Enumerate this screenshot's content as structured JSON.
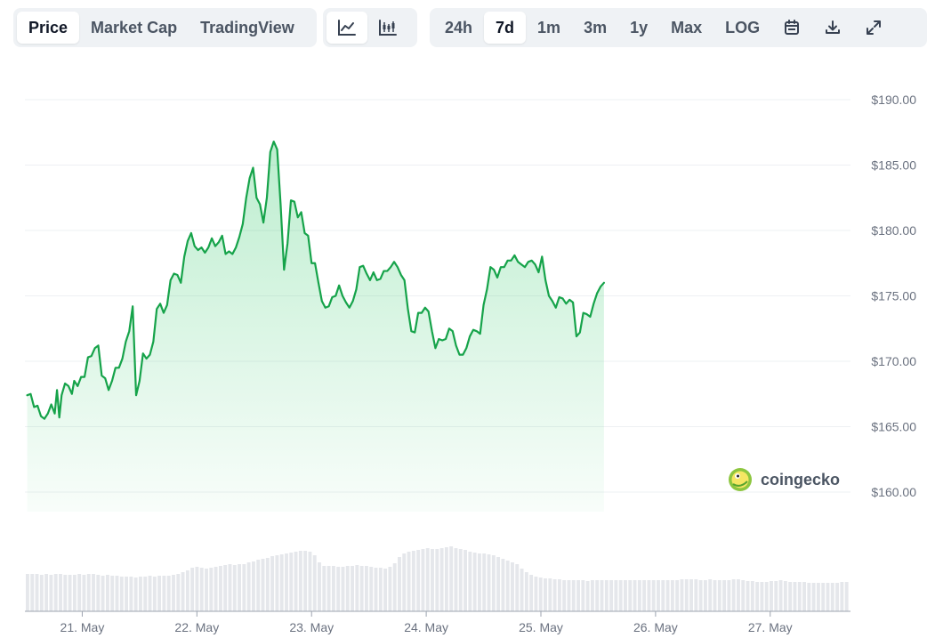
{
  "toolbar": {
    "view_tabs": [
      {
        "label": "Price",
        "active": true
      },
      {
        "label": "Market Cap",
        "active": false
      },
      {
        "label": "TradingView",
        "active": false
      }
    ],
    "chart_type_icons": [
      "line-chart-icon",
      "candlestick-chart-icon"
    ],
    "ranges": [
      {
        "label": "24h",
        "active": false
      },
      {
        "label": "7d",
        "active": true
      },
      {
        "label": "1m",
        "active": false
      },
      {
        "label": "3m",
        "active": false
      },
      {
        "label": "1y",
        "active": false
      },
      {
        "label": "Max",
        "active": false
      }
    ],
    "log_label": "LOG",
    "action_icons": [
      "calendar-icon",
      "download-icon",
      "expand-icon"
    ]
  },
  "watermark": {
    "text": "coingecko"
  },
  "colors": {
    "line": "#16a34a",
    "fill": "#22c55e",
    "volume": "#e5e7eb",
    "grid": "#eef0f3",
    "axis_text": "#6b7280",
    "active_bg": "#ffffff",
    "toolbar_bg": "#eff2f5"
  },
  "chart_data": {
    "type": "area",
    "grid": true,
    "y_axis_position": "right",
    "ylim": [
      158.5,
      191.5
    ],
    "y_ticks": [
      160,
      165,
      170,
      175,
      180,
      185,
      190
    ],
    "y_tick_labels": [
      "$160.00",
      "$165.00",
      "$170.00",
      "$175.00",
      "$180.00",
      "$185.00",
      "$190.00"
    ],
    "xlim": [
      20.5,
      27.7
    ],
    "x_ticks": [
      21,
      22,
      23,
      24,
      25,
      26,
      27
    ],
    "x_tick_labels": [
      "21. May",
      "22. May",
      "23. May",
      "24. May",
      "25. May",
      "26. May",
      "27. May"
    ],
    "series": [
      {
        "type": "area",
        "points": [
          [
            20.52,
            167.4
          ],
          [
            20.55,
            167.5
          ],
          [
            20.58,
            166.5
          ],
          [
            20.61,
            166.6
          ],
          [
            20.64,
            165.8
          ],
          [
            20.67,
            165.6
          ],
          [
            20.7,
            166.0
          ],
          [
            20.73,
            166.7
          ],
          [
            20.76,
            166.0
          ],
          [
            20.78,
            167.8
          ],
          [
            20.8,
            165.7
          ],
          [
            20.82,
            167.4
          ],
          [
            20.85,
            168.3
          ],
          [
            20.88,
            168.1
          ],
          [
            20.91,
            167.5
          ],
          [
            20.93,
            168.5
          ],
          [
            20.96,
            168.1
          ],
          [
            20.99,
            168.8
          ],
          [
            21.02,
            168.8
          ],
          [
            21.05,
            170.3
          ],
          [
            21.08,
            170.4
          ],
          [
            21.11,
            171.0
          ],
          [
            21.14,
            171.2
          ],
          [
            21.17,
            168.9
          ],
          [
            21.2,
            168.7
          ],
          [
            21.23,
            167.8
          ],
          [
            21.26,
            168.5
          ],
          [
            21.29,
            169.5
          ],
          [
            21.32,
            169.5
          ],
          [
            21.35,
            170.2
          ],
          [
            21.38,
            171.5
          ],
          [
            21.41,
            172.3
          ],
          [
            21.44,
            174.2
          ],
          [
            21.47,
            167.4
          ],
          [
            21.5,
            168.5
          ],
          [
            21.53,
            170.6
          ],
          [
            21.56,
            170.2
          ],
          [
            21.59,
            170.5
          ],
          [
            21.62,
            171.5
          ],
          [
            21.65,
            174.0
          ],
          [
            21.68,
            174.4
          ],
          [
            21.71,
            173.7
          ],
          [
            21.74,
            174.3
          ],
          [
            21.77,
            176.2
          ],
          [
            21.8,
            176.7
          ],
          [
            21.83,
            176.6
          ],
          [
            21.86,
            176.0
          ],
          [
            21.89,
            178.0
          ],
          [
            21.92,
            179.2
          ],
          [
            21.95,
            179.8
          ],
          [
            21.98,
            178.8
          ],
          [
            22.01,
            178.5
          ],
          [
            22.04,
            178.7
          ],
          [
            22.07,
            178.3
          ],
          [
            22.1,
            178.7
          ],
          [
            22.13,
            179.4
          ],
          [
            22.16,
            178.8
          ],
          [
            22.19,
            179.1
          ],
          [
            22.22,
            179.6
          ],
          [
            22.25,
            178.2
          ],
          [
            22.28,
            178.4
          ],
          [
            22.31,
            178.2
          ],
          [
            22.34,
            178.7
          ],
          [
            22.37,
            179.5
          ],
          [
            22.4,
            180.5
          ],
          [
            22.43,
            182.5
          ],
          [
            22.46,
            184.0
          ],
          [
            22.49,
            184.8
          ],
          [
            22.52,
            182.5
          ],
          [
            22.55,
            182.0
          ],
          [
            22.58,
            180.6
          ],
          [
            22.61,
            182.5
          ],
          [
            22.64,
            186.0
          ],
          [
            22.67,
            186.8
          ],
          [
            22.7,
            186.2
          ],
          [
            22.73,
            182.0
          ],
          [
            22.76,
            177.0
          ],
          [
            22.79,
            179.0
          ],
          [
            22.82,
            182.3
          ],
          [
            22.85,
            182.2
          ],
          [
            22.88,
            181.0
          ],
          [
            22.91,
            181.4
          ],
          [
            22.94,
            179.8
          ],
          [
            22.97,
            179.6
          ],
          [
            23.0,
            177.5
          ],
          [
            23.03,
            177.5
          ],
          [
            23.06,
            176.0
          ],
          [
            23.09,
            174.6
          ],
          [
            23.12,
            174.1
          ],
          [
            23.15,
            174.2
          ],
          [
            23.18,
            174.9
          ],
          [
            23.21,
            175.0
          ],
          [
            23.24,
            175.8
          ],
          [
            23.27,
            175.0
          ],
          [
            23.3,
            174.5
          ],
          [
            23.33,
            174.1
          ],
          [
            23.36,
            174.6
          ],
          [
            23.39,
            175.5
          ],
          [
            23.42,
            177.2
          ],
          [
            23.45,
            177.3
          ],
          [
            23.48,
            176.7
          ],
          [
            23.51,
            176.2
          ],
          [
            23.54,
            176.8
          ],
          [
            23.57,
            176.2
          ],
          [
            23.6,
            176.3
          ],
          [
            23.63,
            176.9
          ],
          [
            23.66,
            176.9
          ],
          [
            23.69,
            177.2
          ],
          [
            23.72,
            177.6
          ],
          [
            23.75,
            177.2
          ],
          [
            23.78,
            176.6
          ],
          [
            23.81,
            176.2
          ],
          [
            23.84,
            174.0
          ],
          [
            23.87,
            172.3
          ],
          [
            23.9,
            172.2
          ],
          [
            23.93,
            173.7
          ],
          [
            23.96,
            173.7
          ],
          [
            23.99,
            174.1
          ],
          [
            24.02,
            173.8
          ],
          [
            24.05,
            172.3
          ],
          [
            24.08,
            171.0
          ],
          [
            24.11,
            171.7
          ],
          [
            24.14,
            171.6
          ],
          [
            24.17,
            171.7
          ],
          [
            24.2,
            172.5
          ],
          [
            24.23,
            172.3
          ],
          [
            24.26,
            171.2
          ],
          [
            24.29,
            170.5
          ],
          [
            24.32,
            170.5
          ],
          [
            24.35,
            171.0
          ],
          [
            24.38,
            171.9
          ],
          [
            24.41,
            172.4
          ],
          [
            24.44,
            172.3
          ],
          [
            24.47,
            172.1
          ],
          [
            24.5,
            174.3
          ],
          [
            24.53,
            175.5
          ],
          [
            24.56,
            177.2
          ],
          [
            24.59,
            177.0
          ],
          [
            24.62,
            176.4
          ],
          [
            24.65,
            177.2
          ],
          [
            24.68,
            177.2
          ],
          [
            24.71,
            177.7
          ],
          [
            24.74,
            177.7
          ],
          [
            24.77,
            178.1
          ],
          [
            24.8,
            177.6
          ],
          [
            24.83,
            177.4
          ],
          [
            24.86,
            177.2
          ],
          [
            24.89,
            177.6
          ],
          [
            24.92,
            177.7
          ],
          [
            24.95,
            177.4
          ],
          [
            24.98,
            176.8
          ],
          [
            25.01,
            178.0
          ],
          [
            25.04,
            176.2
          ],
          [
            25.07,
            175.0
          ],
          [
            25.1,
            174.6
          ],
          [
            25.13,
            174.1
          ],
          [
            25.16,
            174.9
          ],
          [
            25.19,
            174.8
          ],
          [
            25.22,
            174.4
          ],
          [
            25.25,
            174.7
          ],
          [
            25.28,
            174.5
          ],
          [
            25.31,
            171.9
          ],
          [
            25.34,
            172.2
          ],
          [
            25.37,
            173.7
          ],
          [
            25.4,
            173.6
          ],
          [
            25.43,
            173.4
          ],
          [
            25.46,
            174.4
          ],
          [
            25.49,
            175.2
          ],
          [
            25.52,
            175.7
          ],
          [
            25.55,
            176.0
          ]
        ]
      },
      {
        "type": "volume_bars",
        "name": "",
        "relative_values": [
          0.42,
          0.42,
          0.42,
          0.41,
          0.42,
          0.41,
          0.42,
          0.42,
          0.41,
          0.41,
          0.41,
          0.42,
          0.41,
          0.42,
          0.42,
          0.41,
          0.4,
          0.41,
          0.4,
          0.4,
          0.39,
          0.39,
          0.39,
          0.38,
          0.39,
          0.39,
          0.4,
          0.39,
          0.4,
          0.4,
          0.4,
          0.41,
          0.42,
          0.44,
          0.46,
          0.49,
          0.5,
          0.49,
          0.48,
          0.49,
          0.5,
          0.51,
          0.52,
          0.53,
          0.52,
          0.53,
          0.53,
          0.55,
          0.56,
          0.58,
          0.59,
          0.6,
          0.62,
          0.63,
          0.64,
          0.65,
          0.66,
          0.67,
          0.68,
          0.68,
          0.67,
          0.63,
          0.55,
          0.51,
          0.51,
          0.51,
          0.5,
          0.5,
          0.51,
          0.51,
          0.52,
          0.51,
          0.51,
          0.5,
          0.49,
          0.49,
          0.48,
          0.5,
          0.54,
          0.61,
          0.65,
          0.67,
          0.68,
          0.69,
          0.7,
          0.71,
          0.7,
          0.7,
          0.71,
          0.72,
          0.73,
          0.71,
          0.7,
          0.69,
          0.67,
          0.66,
          0.65,
          0.65,
          0.64,
          0.63,
          0.61,
          0.59,
          0.57,
          0.55,
          0.53,
          0.48,
          0.44,
          0.41,
          0.39,
          0.38,
          0.37,
          0.37,
          0.36,
          0.36,
          0.35,
          0.35,
          0.35,
          0.35,
          0.35,
          0.34,
          0.35,
          0.35,
          0.35,
          0.35,
          0.35,
          0.35,
          0.35,
          0.35,
          0.35,
          0.35,
          0.35,
          0.35,
          0.35,
          0.35,
          0.35,
          0.35,
          0.35,
          0.35,
          0.35,
          0.36,
          0.36,
          0.36,
          0.36,
          0.35,
          0.35,
          0.36,
          0.35,
          0.35,
          0.35,
          0.35,
          0.36,
          0.36,
          0.35,
          0.34,
          0.34,
          0.33,
          0.33,
          0.33,
          0.34,
          0.34,
          0.35,
          0.34,
          0.33,
          0.33,
          0.33,
          0.33,
          0.32,
          0.32,
          0.32,
          0.32,
          0.32,
          0.32,
          0.32,
          0.33,
          0.33
        ]
      }
    ]
  }
}
